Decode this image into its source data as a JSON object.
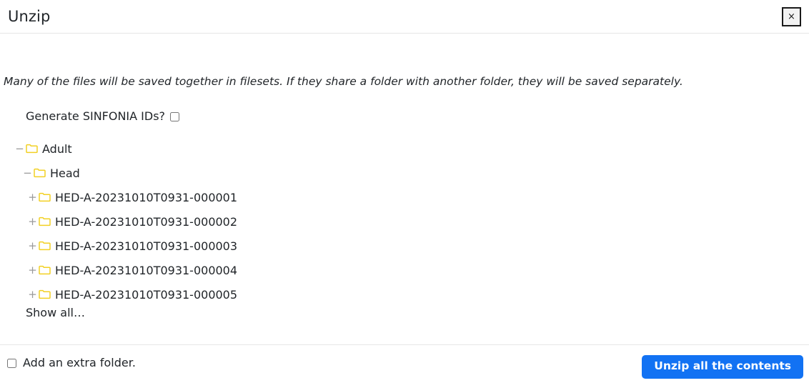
{
  "dialog": {
    "title": "Unzip",
    "close_label": "×",
    "close_icon": "close-icon",
    "intro_text": "Many of the files will be saved together in filesets. If they share a folder with another folder, they will be saved separately."
  },
  "options": {
    "sinfonia_label": "Generate SINFONIA IDs?",
    "sinfonia_checked": false,
    "extra_folder_label": "Add an extra folder.",
    "extra_folder_checked": false
  },
  "tree": {
    "expanded_marker": "−",
    "collapsed_marker": "+",
    "folder_icon": "folder-icon",
    "folder_color": "#f2d023",
    "show_all_label": "Show all…",
    "nodes": [
      {
        "label": "Adult",
        "level": 1,
        "expanded": true
      },
      {
        "label": "Head",
        "level": 2,
        "expanded": true
      },
      {
        "label": "HED-A-20231010T0931-000001",
        "level": 3,
        "expanded": false
      },
      {
        "label": "HED-A-20231010T0931-000002",
        "level": 3,
        "expanded": false
      },
      {
        "label": "HED-A-20231010T0931-000003",
        "level": 3,
        "expanded": false
      },
      {
        "label": "HED-A-20231010T0931-000004",
        "level": 3,
        "expanded": false
      },
      {
        "label": "HED-A-20231010T0931-000005",
        "level": 3,
        "expanded": false
      }
    ]
  },
  "footer": {
    "primary_label": "Unzip all the contents",
    "primary_color": "#1272f3"
  }
}
